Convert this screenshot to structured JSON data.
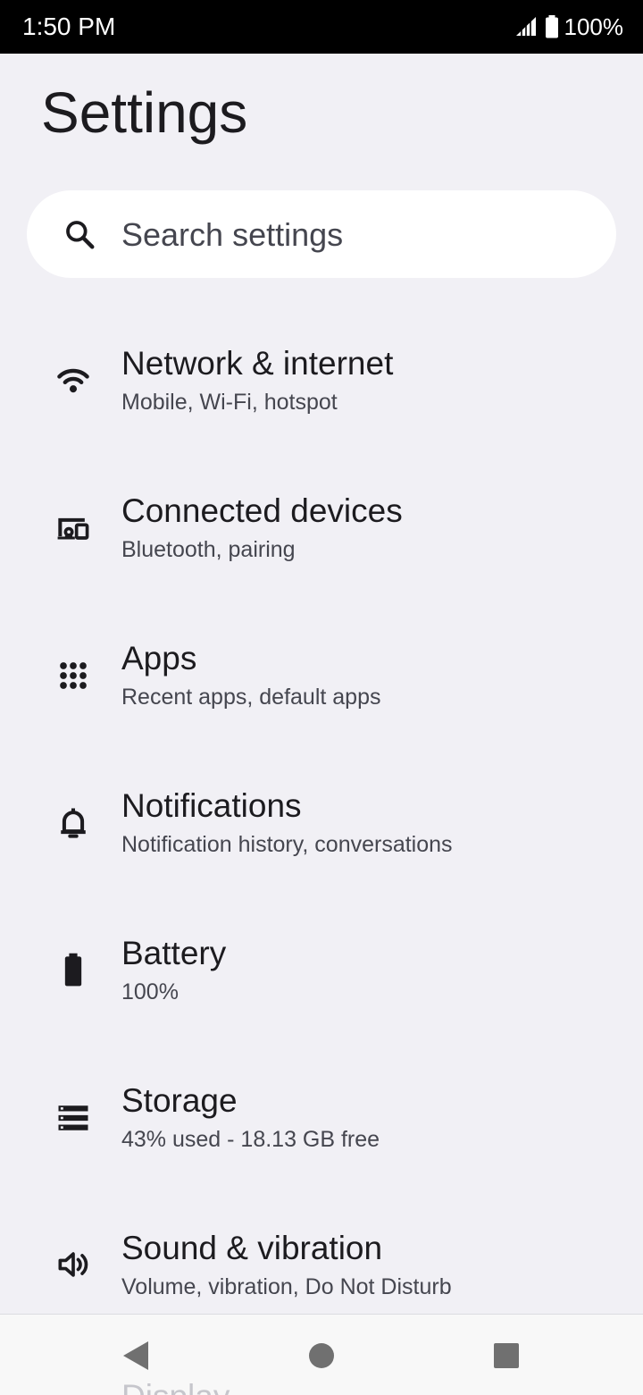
{
  "status_bar": {
    "time": "1:50 PM",
    "battery_percent": "100%",
    "signal_icon": "cell-signal-icon",
    "battery_icon": "battery-full-icon"
  },
  "page": {
    "title": "Settings"
  },
  "search": {
    "placeholder": "Search settings",
    "icon": "search-icon"
  },
  "items": [
    {
      "title": "Network & internet",
      "summary": "Mobile, Wi-Fi, hotspot",
      "icon": "wifi-icon"
    },
    {
      "title": "Connected devices",
      "summary": "Bluetooth, pairing",
      "icon": "devices-icon"
    },
    {
      "title": "Apps",
      "summary": "Recent apps, default apps",
      "icon": "apps-grid-icon"
    },
    {
      "title": "Notifications",
      "summary": "Notification history, conversations",
      "icon": "bell-icon"
    },
    {
      "title": "Battery",
      "summary": "100%",
      "icon": "battery-icon"
    },
    {
      "title": "Storage",
      "summary": "43% used - 18.13 GB free",
      "icon": "storage-icon"
    },
    {
      "title": "Sound & vibration",
      "summary": "Volume, vibration, Do Not Disturb",
      "icon": "speaker-icon"
    },
    {
      "title": "Display",
      "icon": "display-icon"
    }
  ],
  "nav_bar": {
    "back_icon": "back-triangle-icon",
    "home_icon": "home-circle-icon",
    "recents_icon": "recents-square-icon"
  },
  "colors": {
    "background": "#f1f0f5",
    "status_bar": "#000000",
    "search_bg": "#ffffff",
    "title_text": "#1c1b1f",
    "summary_text": "#45464f",
    "nav_bar": "#f8f8f8"
  }
}
